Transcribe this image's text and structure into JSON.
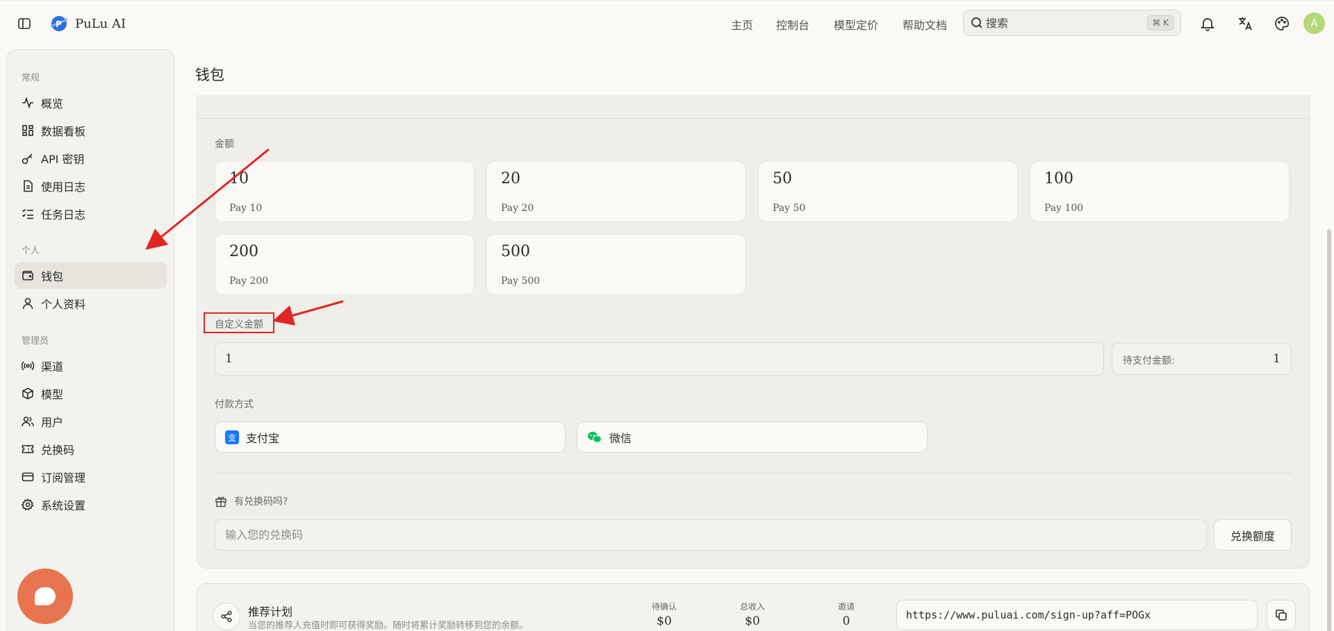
{
  "header": {
    "brand": "PuLu AI",
    "nav": [
      "主页",
      "控制台",
      "模型定价",
      "帮助文档"
    ],
    "search_placeholder": "搜索",
    "search_shortcut": "⌘ K",
    "avatar_letter": "A"
  },
  "sidebar": {
    "sections": [
      {
        "title": "常规",
        "items": [
          "概览",
          "数据看板",
          "API 密钥",
          "使用日志",
          "任务日志"
        ]
      },
      {
        "title": "个人",
        "items": [
          "钱包",
          "个人资料"
        ]
      },
      {
        "title": "管理员",
        "items": [
          "渠道",
          "模型",
          "用户",
          "兑换码",
          "订阅管理",
          "系统设置"
        ]
      }
    ],
    "active_item": "钱包"
  },
  "main": {
    "title": "钱包",
    "amount_label": "金额",
    "amounts": [
      {
        "value": "10",
        "pay": "Pay 10"
      },
      {
        "value": "20",
        "pay": "Pay 20"
      },
      {
        "value": "50",
        "pay": "Pay 50"
      },
      {
        "value": "100",
        "pay": "Pay 100"
      },
      {
        "value": "200",
        "pay": "Pay 200"
      },
      {
        "value": "500",
        "pay": "Pay 500"
      }
    ],
    "custom_amount_label": "自定义金额",
    "custom_amount_value": "1",
    "pending_label": "待支付金额:",
    "pending_value": "1",
    "payment_label": "付款方式",
    "payment_methods": [
      "支付宝",
      "微信"
    ],
    "redeem_label": "有兑换码吗?",
    "redeem_placeholder": "输入您的兑换码",
    "redeem_button": "兑换额度"
  },
  "referral": {
    "title": "推荐计划",
    "description": "当您的推荐人充值时即可获得奖励。随时将累计奖励转移到您的余额。",
    "stats": [
      {
        "label": "待确认",
        "value": "$0"
      },
      {
        "label": "总收入",
        "value": "$0"
      },
      {
        "label": "邀请",
        "value": "0"
      }
    ],
    "link": "https://www.puluai.com/sign-up?aff=POGx"
  },
  "colors": {
    "background": "#faf9f5",
    "annotation": "#e02525",
    "alipay": "#1677ff",
    "wechat": "#07c160",
    "chat_bubble": "#e8734f"
  }
}
